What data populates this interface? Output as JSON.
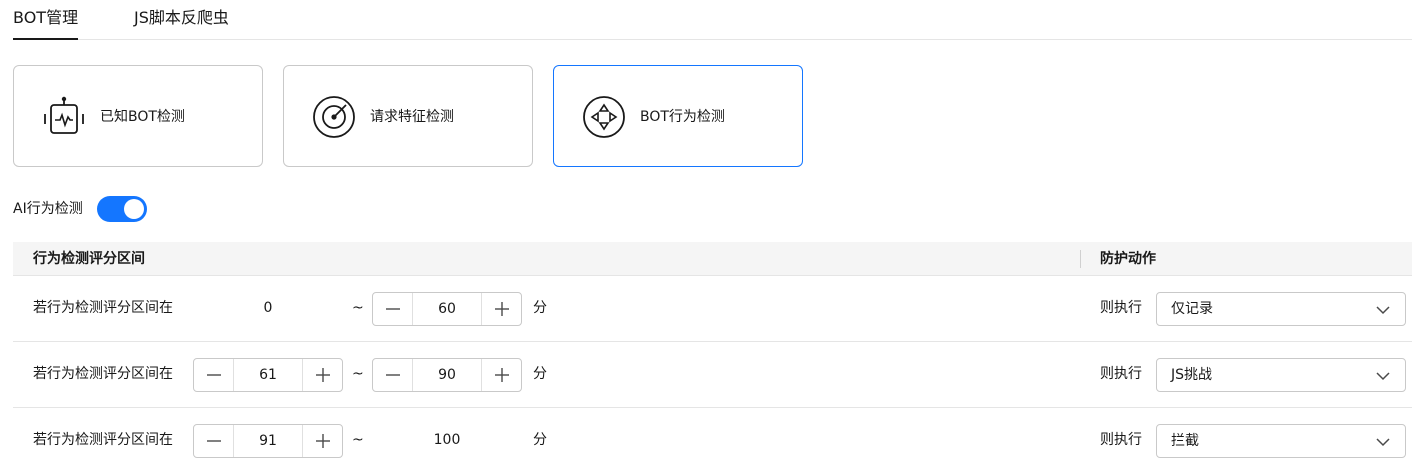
{
  "tabs": [
    {
      "label": "BOT管理"
    },
    {
      "label": "JS脚本反爬虫"
    }
  ],
  "cards": [
    {
      "label": "已知BOT检测",
      "icon": "robot-icon"
    },
    {
      "label": "请求特征检测",
      "icon": "radar-icon"
    },
    {
      "label": "BOT行为检测",
      "icon": "gamepad-icon"
    }
  ],
  "ai_detection": {
    "label": "AI行为检测",
    "enabled": true
  },
  "table": {
    "col_range": "行为检测评分区间",
    "col_action": "防护动作",
    "rows": [
      {
        "label": "若行为检测评分区间在",
        "from": "0",
        "tilde": "~",
        "to": "60",
        "unit": "分",
        "exec_label": "则执行",
        "action": "仅记录"
      },
      {
        "label": "若行为检测评分区间在",
        "from": "61",
        "tilde": "~",
        "to": "90",
        "unit": "分",
        "exec_label": "则执行",
        "action": "JS挑战"
      },
      {
        "label": "若行为检测评分区间在",
        "from": "91",
        "tilde": "~",
        "to": "100",
        "unit": "分",
        "exec_label": "则执行",
        "action": "拦截"
      }
    ]
  },
  "colors": {
    "accent": "#1476ff",
    "border": "#c9c9c9",
    "header_bg": "#f5f5f5"
  }
}
